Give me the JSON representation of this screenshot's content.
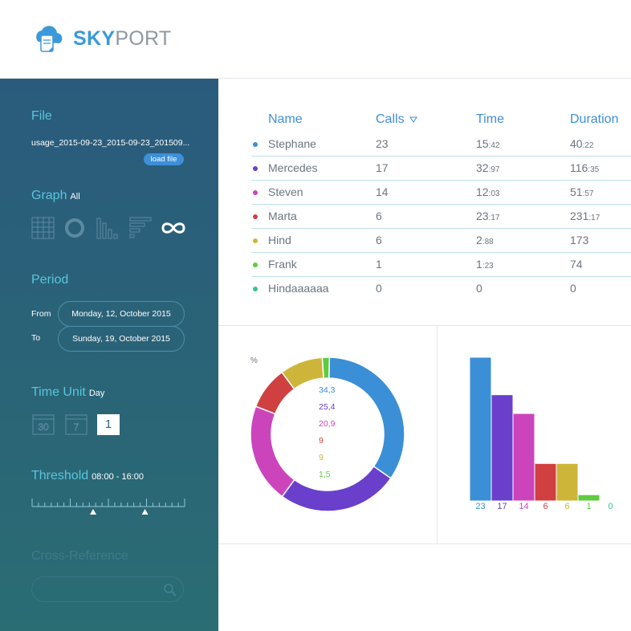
{
  "brand": {
    "sky": "SKY",
    "port": "PORT"
  },
  "sidebar": {
    "file": {
      "title": "File",
      "filename": "usage_2015-09-23_2015-09-23_201509...",
      "load_label": "load file"
    },
    "graph": {
      "title": "Graph",
      "sub": "All",
      "icons": [
        "table-icon",
        "donut-icon",
        "bar-chart-icon",
        "horizontal-bar-icon",
        "infinity-icon"
      ]
    },
    "period": {
      "title": "Period",
      "from_label": "From",
      "from_value": "Monday, 12, October 2015",
      "to_label": "To",
      "to_value": "Sunday, 19, October 2015"
    },
    "time_unit": {
      "title": "Time Unit",
      "sub": "Day",
      "icons": [
        "month-calendar-icon",
        "week-calendar-icon"
      ],
      "active": "1"
    },
    "threshold": {
      "title": "Threshold",
      "sub": "08:00 - 16:00",
      "low_fraction": 0.4,
      "high_fraction": 0.74
    },
    "cross_reference": {
      "title": "Cross-Reference"
    }
  },
  "table": {
    "headers": {
      "name": "Name",
      "calls": "Calls",
      "time": "Time",
      "duration": "Duration"
    },
    "rows": [
      {
        "name": "Stephane",
        "calls": "23",
        "time_main": "15",
        "time_small": ":42",
        "dur_main": "40",
        "dur_small": ":22",
        "color": "#3a8fd6"
      },
      {
        "name": "Mercedes",
        "calls": "17",
        "time_main": "32",
        "time_small": ":97",
        "dur_main": "116",
        "dur_small": ":35",
        "color": "#6a3fcc"
      },
      {
        "name": "Steven",
        "calls": "14",
        "time_main": "12",
        "time_small": ":03",
        "dur_main": "51",
        "dur_small": ":57",
        "color": "#cc44bb"
      },
      {
        "name": "Marta",
        "calls": "6",
        "time_main": "23",
        "time_small": ":17",
        "dur_main": "231",
        "dur_small": ":17",
        "color": "#d04040"
      },
      {
        "name": "Hind",
        "calls": "6",
        "time_main": "2",
        "time_small": ":88",
        "dur_main": "173",
        "dur_small": "",
        "color": "#cdb53a"
      },
      {
        "name": "Frank",
        "calls": "1",
        "time_main": "1",
        "time_small": ":23",
        "dur_main": "74",
        "dur_small": "",
        "color": "#5ecc3e"
      },
      {
        "name": "Hindaaaaaa",
        "calls": "0",
        "time_main": "0",
        "time_small": "",
        "dur_main": "0",
        "dur_small": "",
        "color": "#34c58a"
      }
    ]
  },
  "chart_data": [
    {
      "type": "pie",
      "title": "%",
      "labels": [
        "Stephane",
        "Mercedes",
        "Steven",
        "Marta",
        "Hind",
        "Frank"
      ],
      "values": [
        34.3,
        25.4,
        20.9,
        9,
        9,
        1.5
      ],
      "value_labels": [
        "34,3",
        "25,4",
        "20,9",
        "9",
        "9",
        "1,5"
      ],
      "colors": [
        "#3a8fd6",
        "#6a3fcc",
        "#cc44bb",
        "#d04040",
        "#cdb53a",
        "#5ecc3e"
      ]
    },
    {
      "type": "bar",
      "categories": [
        "Stephane",
        "Mercedes",
        "Steven",
        "Marta",
        "Hind",
        "Frank",
        "Hindaaaaaa"
      ],
      "values": [
        23,
        17,
        14,
        6,
        6,
        1,
        0
      ],
      "colors": [
        "#3a8fd6",
        "#6a3fcc",
        "#cc44bb",
        "#d04040",
        "#cdb53a",
        "#5ecc3e",
        "#34c58a"
      ],
      "ylim": [
        0,
        23
      ]
    }
  ]
}
